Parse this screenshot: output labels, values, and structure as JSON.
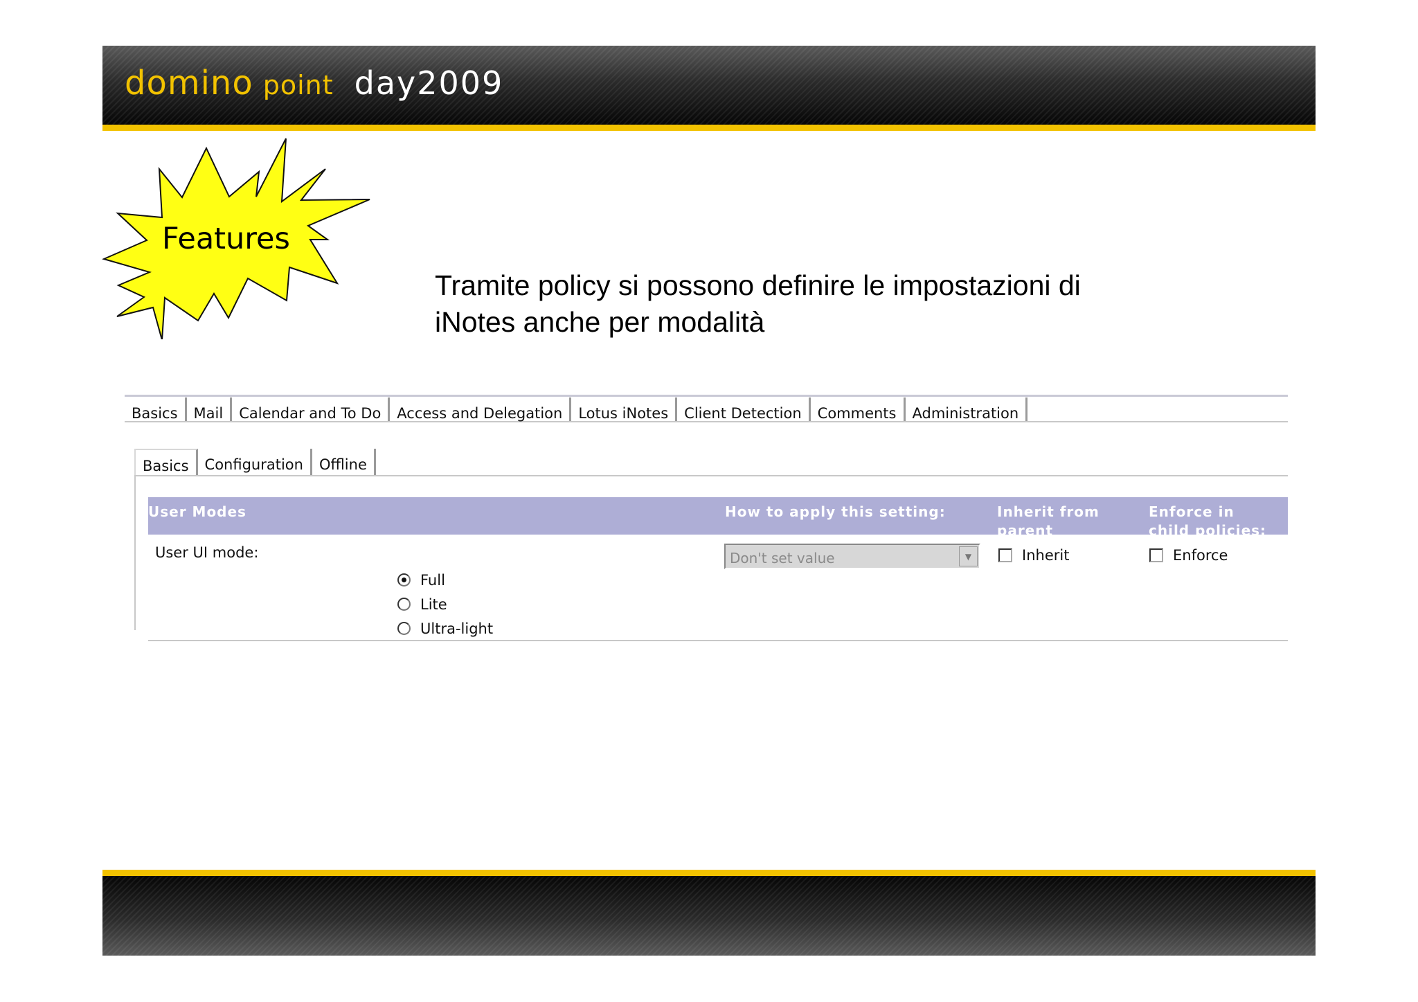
{
  "header": {
    "logo_word1": "domino",
    "logo_word2": "point",
    "logo_word3": "day2009"
  },
  "colors": {
    "brand_yellow": "#f2c200",
    "bar_dark": "#0a0a0a",
    "table_header": "#aeaed6"
  },
  "badge": {
    "label": "Features"
  },
  "intro": {
    "line1": "Tramite policy si possono definire le impostazioni di",
    "line2": "iNotes anche per modalità"
  },
  "tabs": [
    {
      "label": "Basics"
    },
    {
      "label": "Mail"
    },
    {
      "label": "Calendar and To Do"
    },
    {
      "label": "Access and Delegation"
    },
    {
      "label": "Lotus iNotes"
    },
    {
      "label": "Client Detection"
    },
    {
      "label": "Comments"
    },
    {
      "label": "Administration"
    }
  ],
  "active_tab": "Lotus iNotes",
  "subtabs": [
    {
      "label": "Basics"
    },
    {
      "label": "Configuration"
    },
    {
      "label": "Offline"
    }
  ],
  "active_subtab": "Basics",
  "table": {
    "col1": "User Modes",
    "col2": "How to apply this setting:",
    "col3": "Inherit from parent policy:",
    "col4": "Enforce in child policies:"
  },
  "setting": {
    "label": "User UI mode:",
    "options": [
      "Full",
      "Lite",
      "Ultra-light"
    ],
    "selected": "Full",
    "apply_value": "Don't set value",
    "inherit_label": "Inherit",
    "inherit_checked": false,
    "enforce_label": "Enforce",
    "enforce_checked": false
  },
  "icons": {
    "dropdown": "chevron-down-icon"
  }
}
